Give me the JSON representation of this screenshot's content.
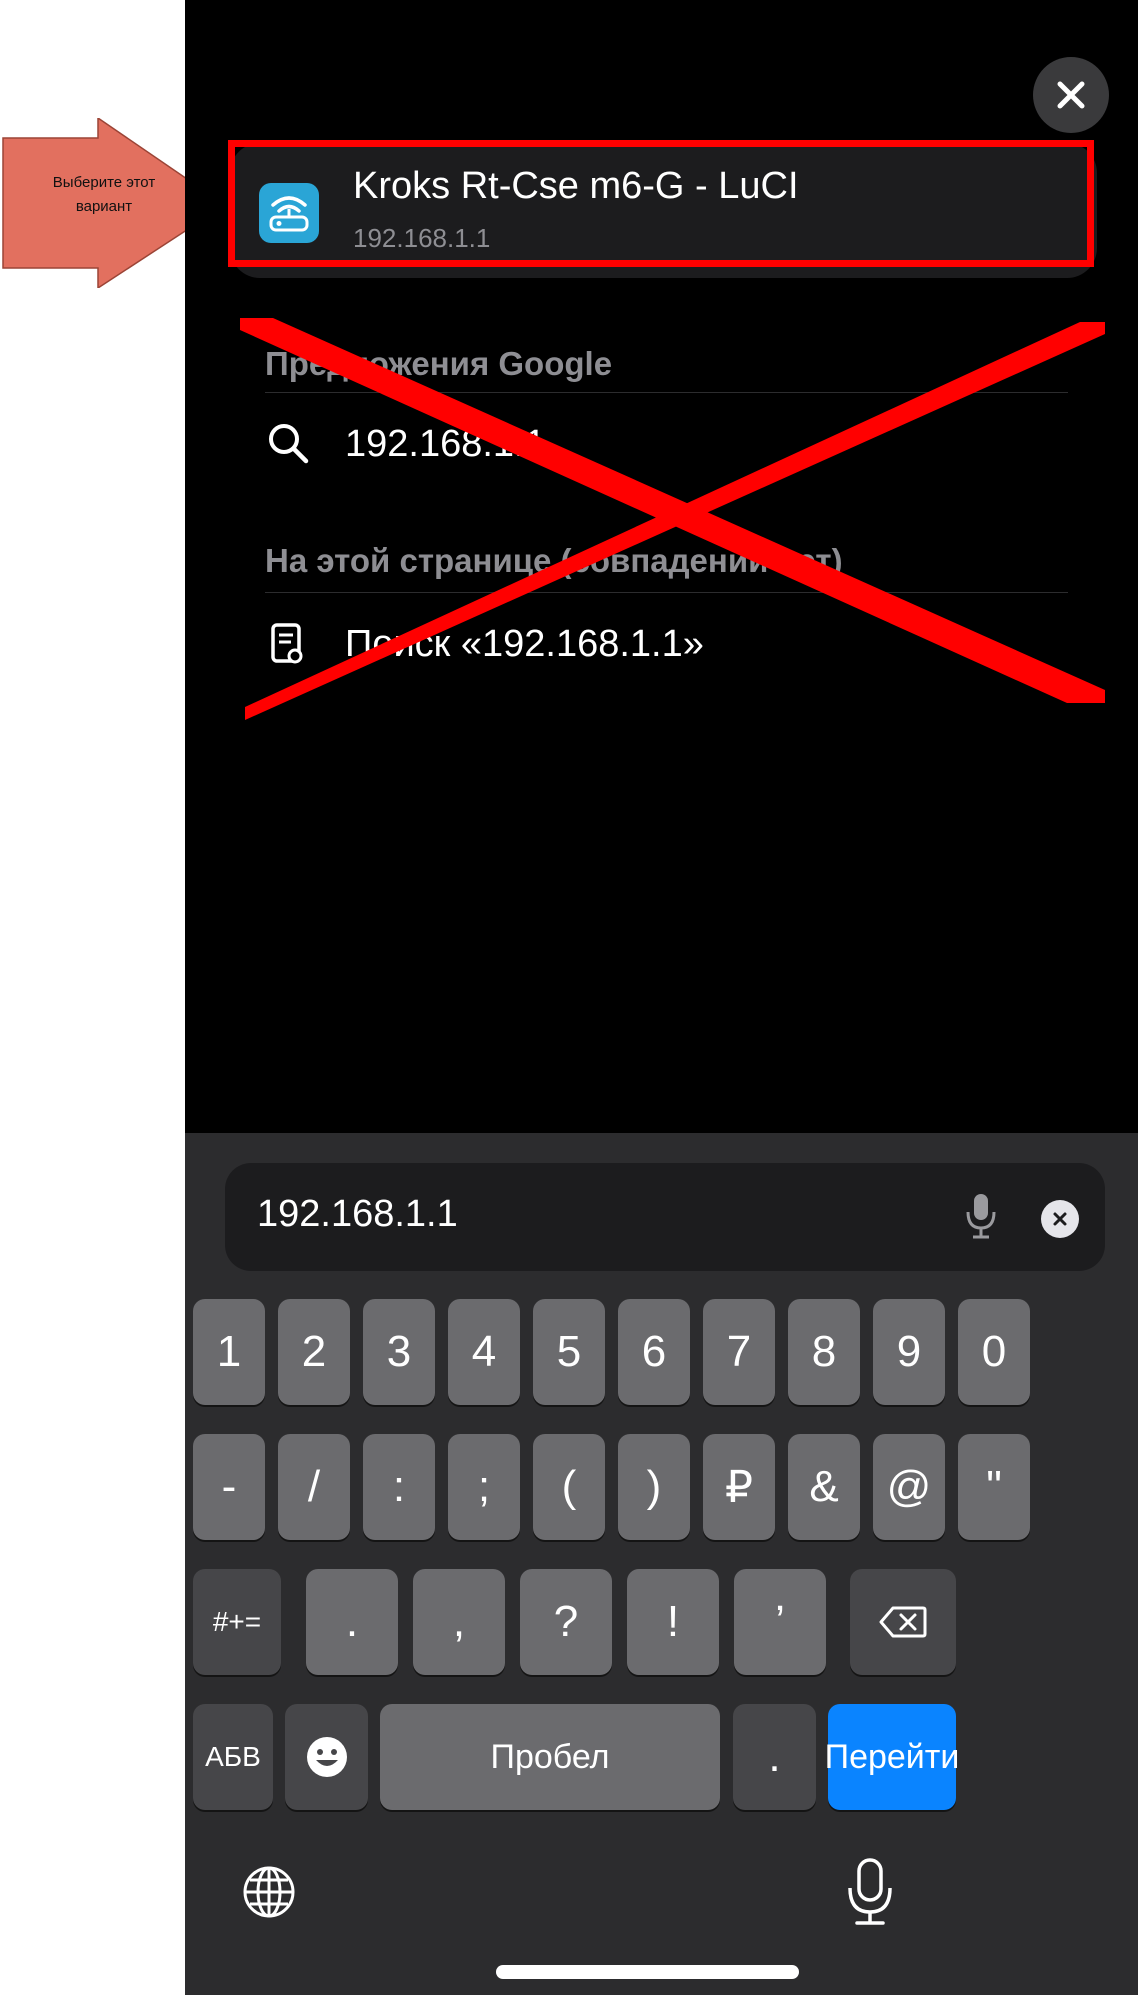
{
  "annotation": {
    "callout_text": "Выберите этот вариант",
    "accent_color": "#e2705f",
    "highlight_color": "#ff0000"
  },
  "header": {
    "close_icon": "close-icon"
  },
  "top_result": {
    "title": "Kroks Rt-Cse m6-G - LuCI",
    "url": "192.168.1.1",
    "icon": "router-wifi-icon"
  },
  "google_suggestions": {
    "heading": "Предложения Google",
    "items": [
      {
        "text": "192.168.1.1",
        "icon": "search-icon"
      }
    ]
  },
  "on_page": {
    "heading": "На этой странице (совпадений нет)",
    "items": [
      {
        "text": "Поиск «192.168.1.1»",
        "icon": "document-search-icon"
      }
    ]
  },
  "search_field": {
    "value": "192.168.1.1",
    "mic_icon": "microphone-icon",
    "clear_icon": "clear-icon"
  },
  "keyboard": {
    "row1": [
      "1",
      "2",
      "3",
      "4",
      "5",
      "6",
      "7",
      "8",
      "9",
      "0"
    ],
    "row2": [
      "-",
      "/",
      ":",
      ";",
      "(",
      ")",
      "₽",
      "&",
      "@",
      "\""
    ],
    "row3": {
      "shift_label": "#+=",
      "keys": [
        ".",
        ",",
        "?",
        "!",
        "’"
      ],
      "backspace_icon": "backspace-icon"
    },
    "row4": {
      "abc_label": "АБВ",
      "emoji_icon": "emoji-icon",
      "space_label": "Пробел",
      "period_label": ".",
      "go_label": "Перейти"
    },
    "globe_icon": "globe-icon",
    "dictation_icon": "microphone-icon"
  },
  "colors": {
    "background": "#000000",
    "card": "#1c1c1e",
    "key": "#6b6b6e",
    "key_dark": "#464649",
    "go_key": "#0a84ff"
  }
}
